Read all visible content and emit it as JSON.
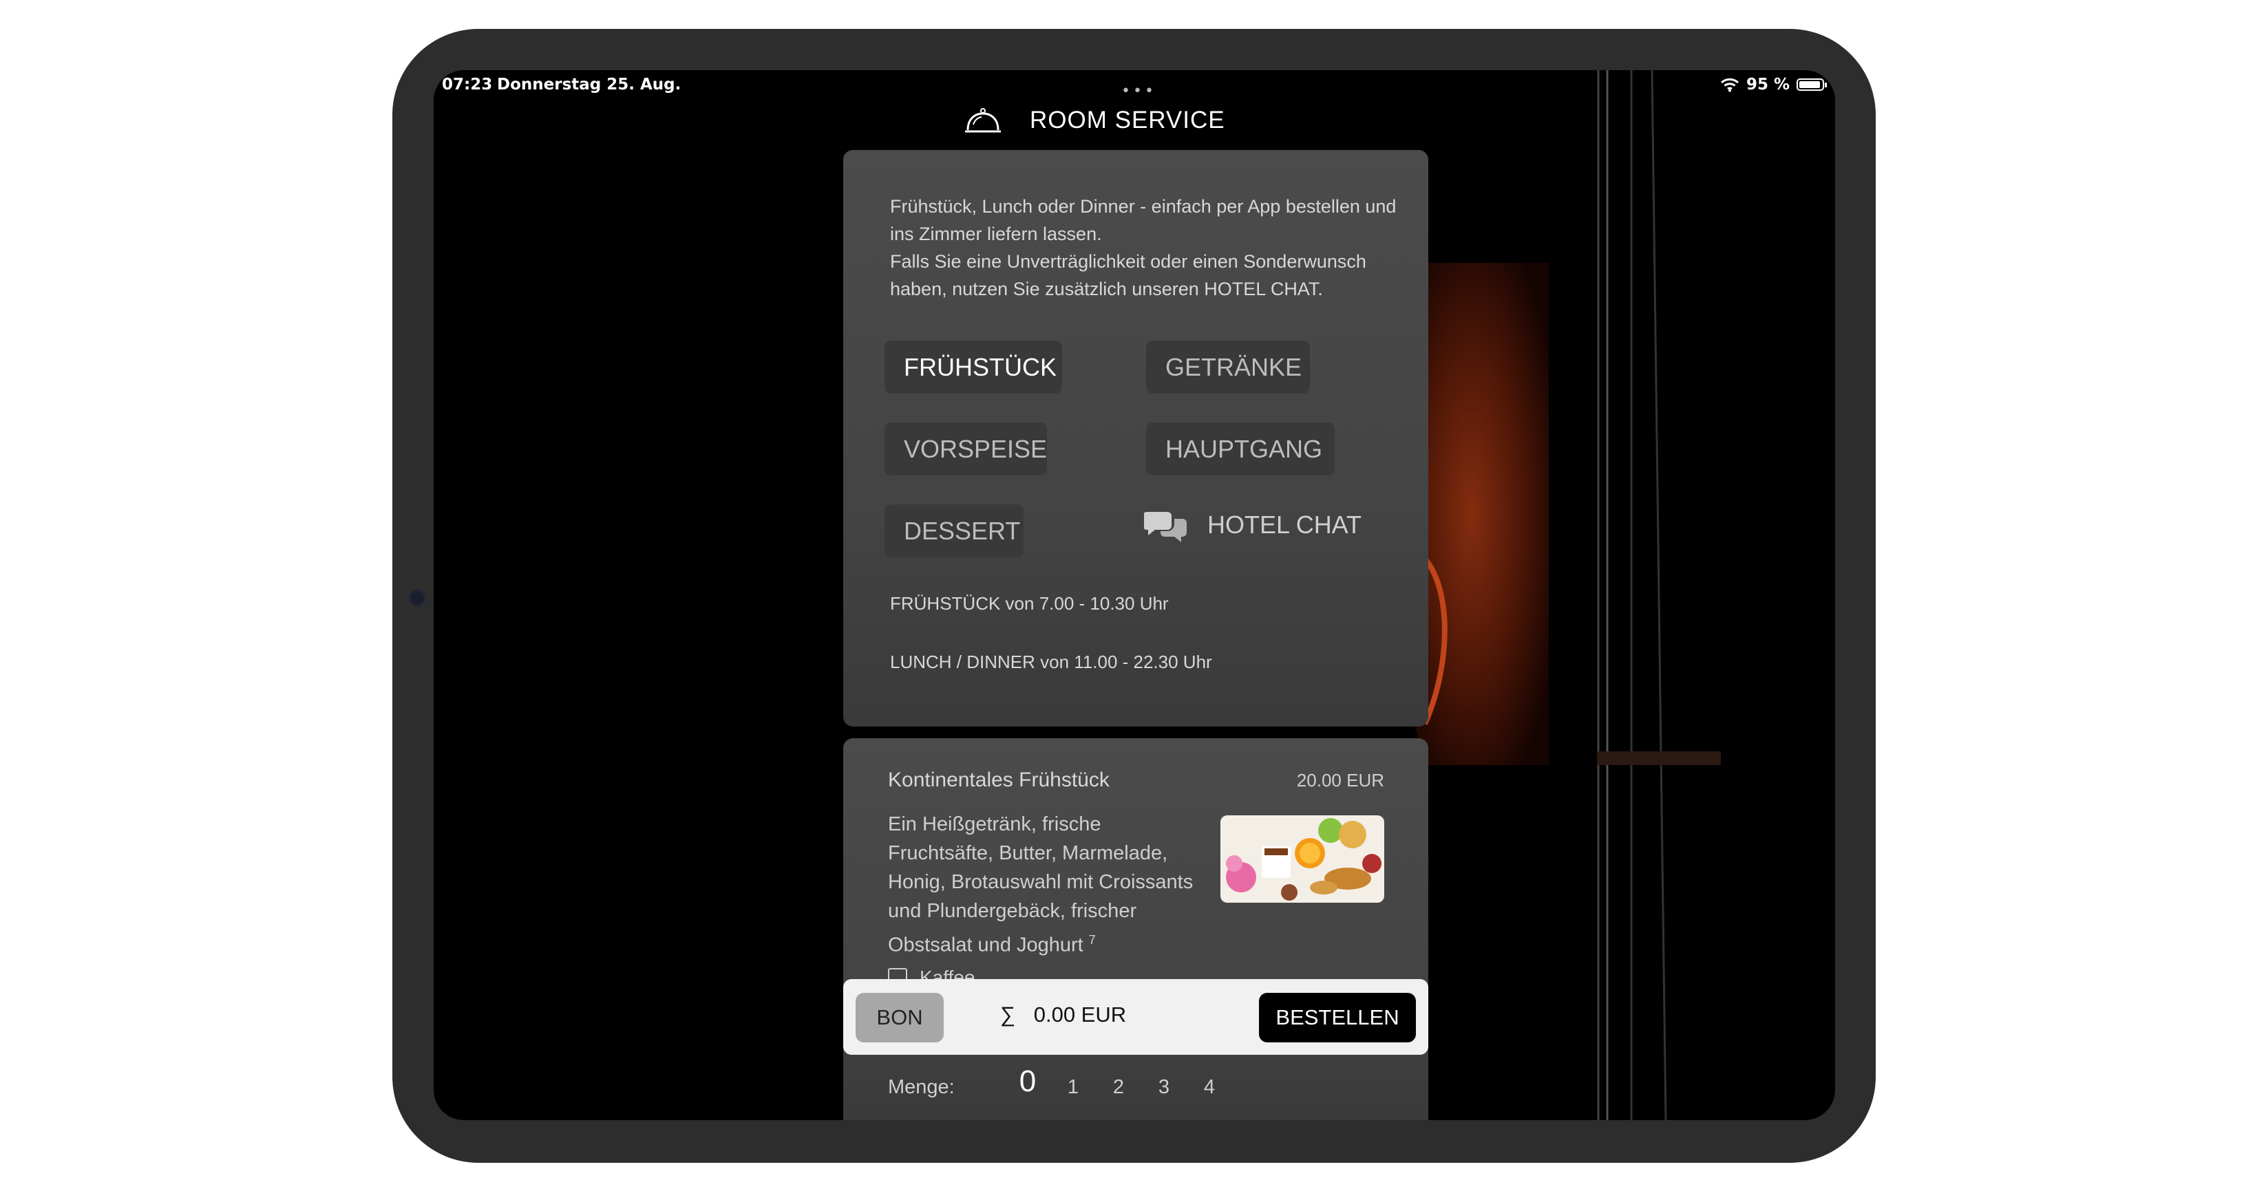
{
  "status_bar": {
    "time": "07:23",
    "date": "Donnerstag 25. Aug.",
    "battery": "95 %"
  },
  "nav": {
    "title": "ROOM SERVICE"
  },
  "intro": {
    "line1": "Frühstück, Lunch oder Dinner - einfach per App bestellen und ins Zimmer liefern lassen.",
    "line2": "Falls Sie eine Unverträglichkeit oder einen Sonderwunsch haben, nutzen Sie zusätzlich unseren HOTEL CHAT."
  },
  "categories": {
    "fruehstueck": "FRÜHSTÜCK",
    "getraenke": "GETRÄNKE",
    "vorspeise": "VORSPEISE",
    "hauptgang": "HAUPTGANG",
    "dessert": "DESSERT",
    "hotel_chat": "HOTEL CHAT",
    "active": "FRÜHSTÜCK"
  },
  "hours": {
    "breakfast": "FRÜHSTÜCK von 7.00 - 10.30 Uhr",
    "lunch_dinner": "LUNCH / DINNER von 11.00 - 22.30 Uhr"
  },
  "item": {
    "title": "Kontinentales Frühstück",
    "price": "20.00 EUR",
    "description": "Ein Heißgetränk, frische Fruchtsäfte, Butter, Marmelade, Honig, Brotauswahl mit Croissants und Plundergebäck, frischer Obstsalat und Joghurt",
    "allergen_note": "7",
    "option_label": "Kaffee",
    "quantity_label": "Menge:",
    "quantities": [
      "0",
      "1",
      "2",
      "3",
      "4"
    ],
    "selected_quantity": "0"
  },
  "order_bar": {
    "bon": "BON",
    "sum_symbol": "∑",
    "total": "0.00 EUR",
    "order_button": "BESTELLEN"
  },
  "colors": {
    "background": "#000000",
    "panel": "#474747",
    "order_bar": "#f1f1f1",
    "violin_accent": "#8a2a10"
  },
  "icons": [
    "cloche-icon",
    "chat-bubbles-icon",
    "wifi-icon",
    "battery-icon"
  ]
}
